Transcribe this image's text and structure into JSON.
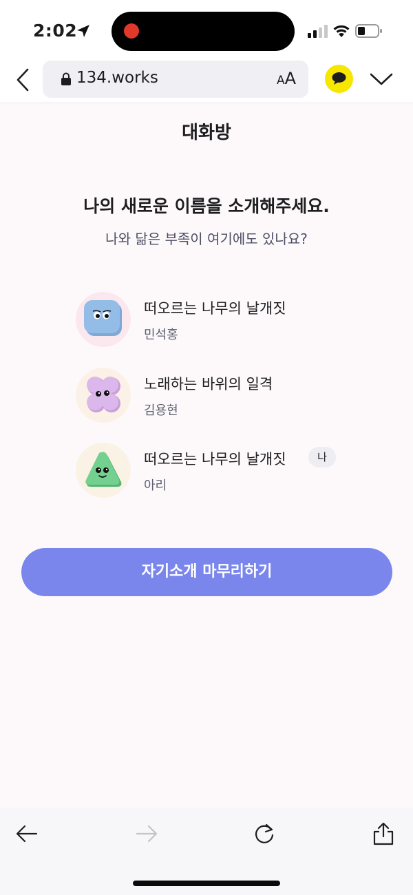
{
  "status_bar": {
    "time": "2:02"
  },
  "browser": {
    "url": "134.works",
    "text_size_big": "A",
    "text_size_small": "A"
  },
  "page": {
    "title": "대화방",
    "headline": "나의 새로운 이름을 소개해주세요.",
    "subheadline": "나와 닮은 부족이 여기에도 있나요?",
    "members": [
      {
        "name": "떠오르는 나무의 날개짓",
        "subname": "민석홍",
        "avatar_color": "#8fb9e2",
        "avatar_bg": "#fbe8ef",
        "avatar_shape": "square",
        "is_me": false
      },
      {
        "name": "노래하는 바위의 일격",
        "subname": "김용현",
        "avatar_color": "#d5b0e4",
        "avatar_bg": "#fbf1e6",
        "avatar_shape": "clover",
        "is_me": false
      },
      {
        "name": "떠오르는 나무의 날개짓",
        "subname": "아리",
        "avatar_color": "#6ec98a",
        "avatar_bg": "#fbf2e6",
        "avatar_shape": "triangle",
        "is_me": true
      }
    ],
    "me_badge": "나",
    "finish_button": "자기소개 마무리하기"
  },
  "colors": {
    "accent": "#7b86ec",
    "kakao": "#f7e600",
    "background": "#fdf9fb"
  }
}
